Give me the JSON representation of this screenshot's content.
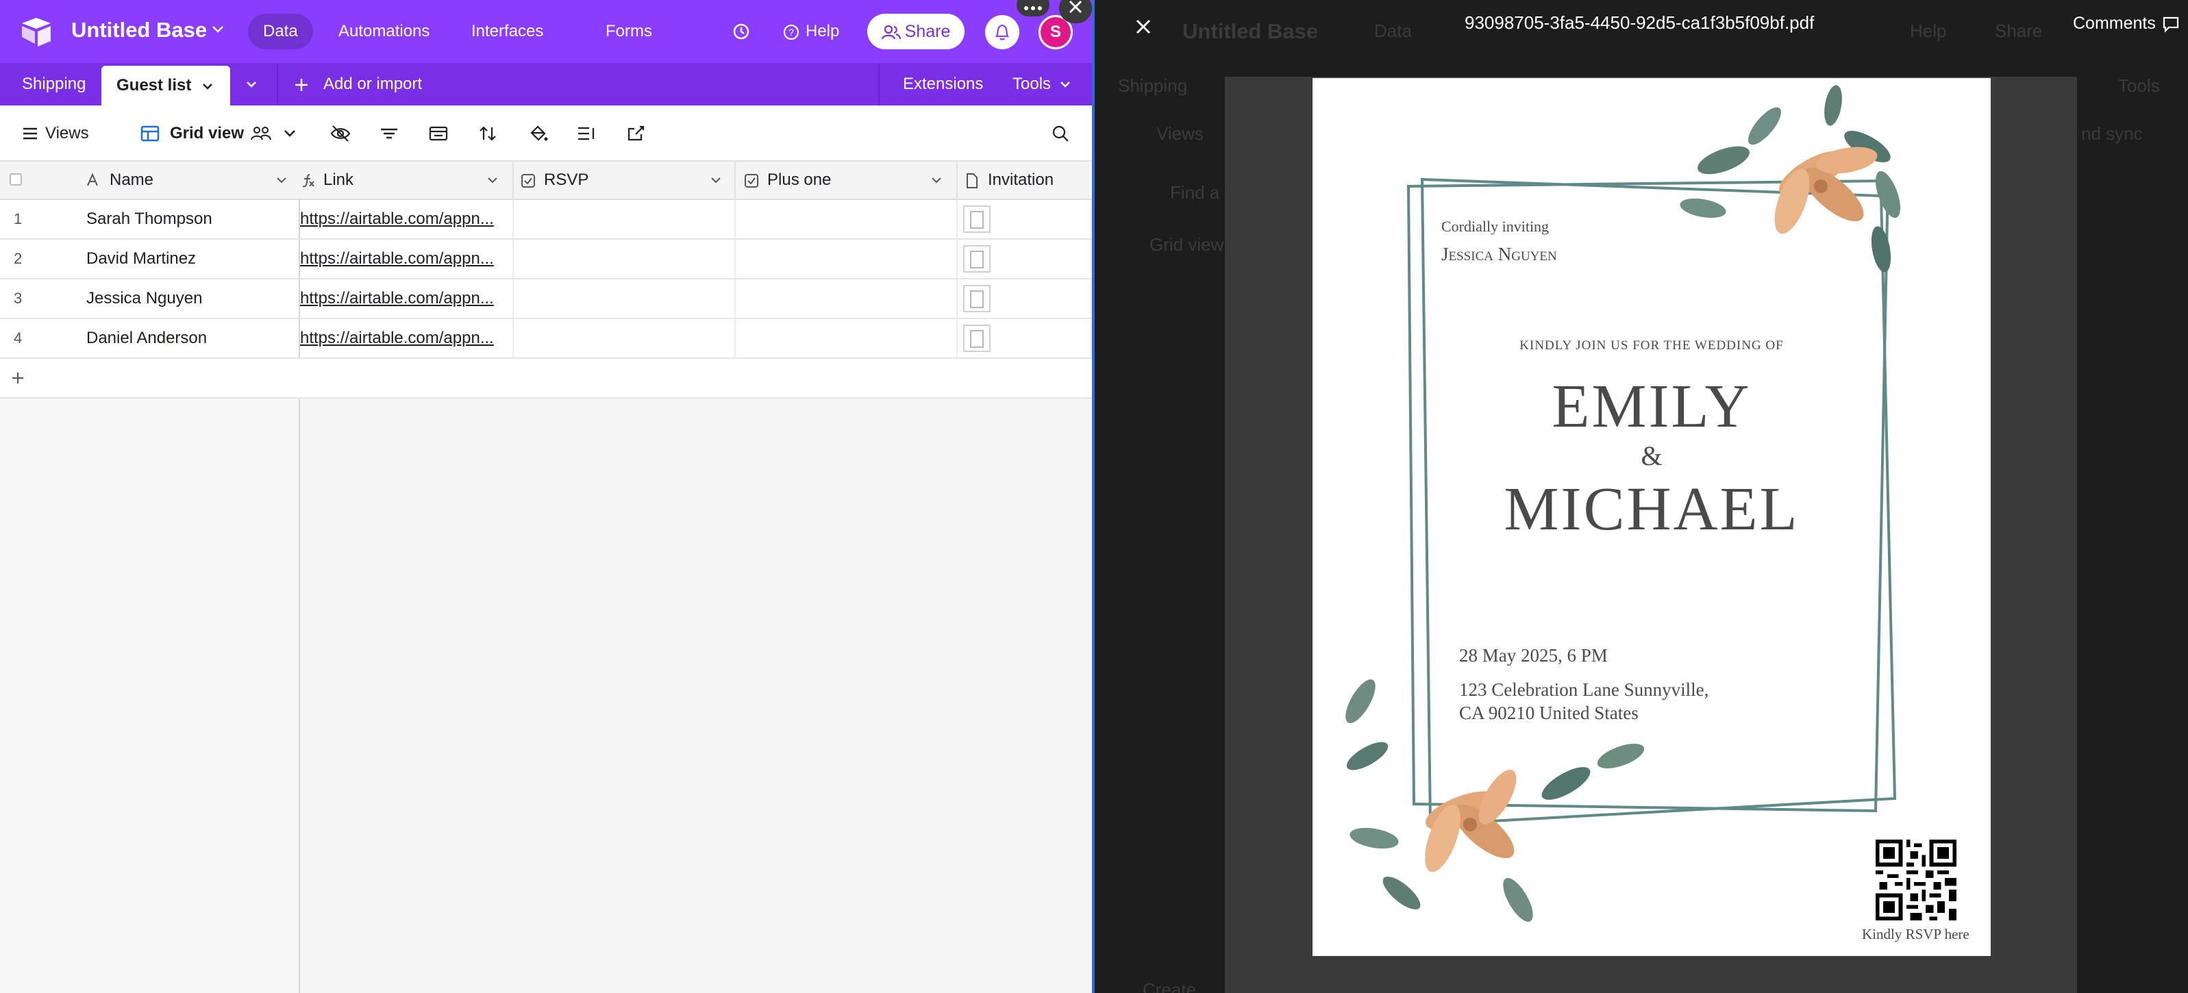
{
  "app": {
    "base_name": "Untitled Base",
    "nav": [
      "Data",
      "Automations",
      "Interfaces",
      "Forms"
    ],
    "help_label": "Help",
    "share_label": "Share",
    "avatar_initial": "S",
    "brand_color": "#8b3dff"
  },
  "tabs": {
    "shipping": "Shipping",
    "guest_list": "Guest list",
    "add_import": "Add or import",
    "extensions": "Extensions",
    "tools": "Tools"
  },
  "viewbar": {
    "views_label": "Views",
    "grid_view_label": "Grid view"
  },
  "table": {
    "columns": [
      "Name",
      "Link",
      "RSVP",
      "Plus one",
      "Invitation"
    ],
    "rows": [
      {
        "num": "1",
        "name": "Sarah Thompson",
        "link": "https://airtable.com/appn..."
      },
      {
        "num": "2",
        "name": "David Martinez",
        "link": "https://airtable.com/appn..."
      },
      {
        "num": "3",
        "name": "Jessica Nguyen",
        "link": "https://airtable.com/appn..."
      },
      {
        "num": "4",
        "name": "Daniel Anderson",
        "link": "https://airtable.com/appn..."
      }
    ]
  },
  "preview": {
    "filename": "93098705-3fa5-4450-92d5-ca1f3b5f09bf.pdf",
    "comments_label": "Comments",
    "ghost_labels": {
      "base": "Untitled Base",
      "data": "Data",
      "help": "Help",
      "share": "Share",
      "shipping": "Shipping",
      "tools": "Tools",
      "views": "Views",
      "find": "Find a v",
      "grid": "Grid view",
      "sync": "nd sync",
      "create": "Create"
    }
  },
  "invitation": {
    "cordially": "Cordially inviting",
    "guest": "Jessica Nguyen",
    "kindly_join": "KINDLY JOIN US FOR THE WEDDING OF",
    "bride": "EMILY",
    "amp": "&",
    "groom": "MICHAEL",
    "datetime": "28 May 2025, 6 PM",
    "address_line1": "123 Celebration Lane Sunnyville,",
    "address_line2": "CA 90210 United States",
    "rsvp_note": "Kindly RSVP here"
  }
}
